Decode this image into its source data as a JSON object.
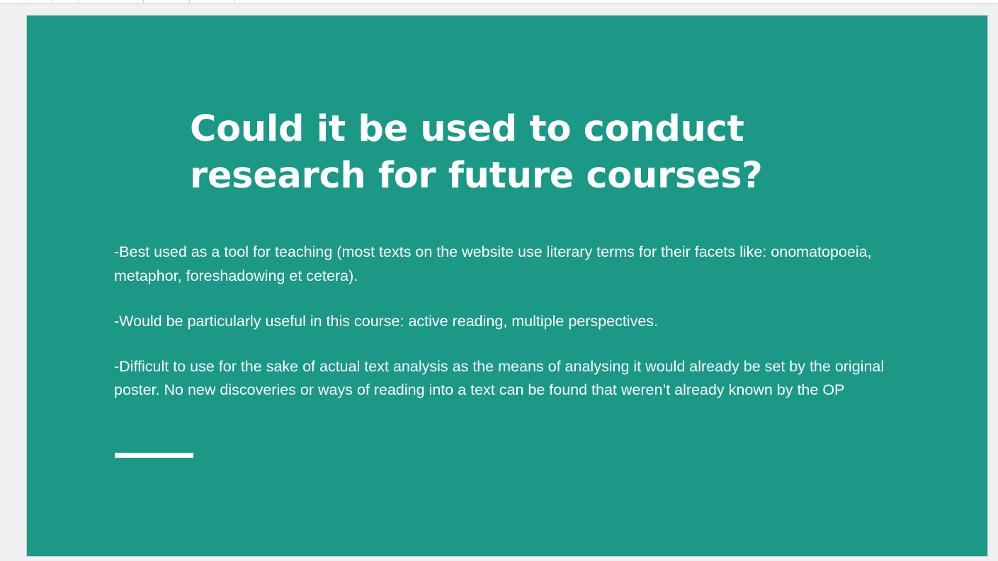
{
  "slide": {
    "title": "Could it be used to conduct research for future courses?",
    "paragraphs": [
      "-Best used as a tool for teaching (most texts on the website use literary terms for their facets like: onomatopoeia, metaphor, foreshadowing et cetera).",
      "-Would be particularly useful in this course: active reading, multiple perspectives.",
      "-Difficult to use for the sake of actual text analysis as the means of analysing it would already be set by the original poster. No new discoveries or ways of reading into a text can be found that weren’t already known by the OP"
    ]
  },
  "colors": {
    "slide_background": "#1b9886",
    "text": "#ffffff",
    "workspace": "#f0f0f0"
  }
}
